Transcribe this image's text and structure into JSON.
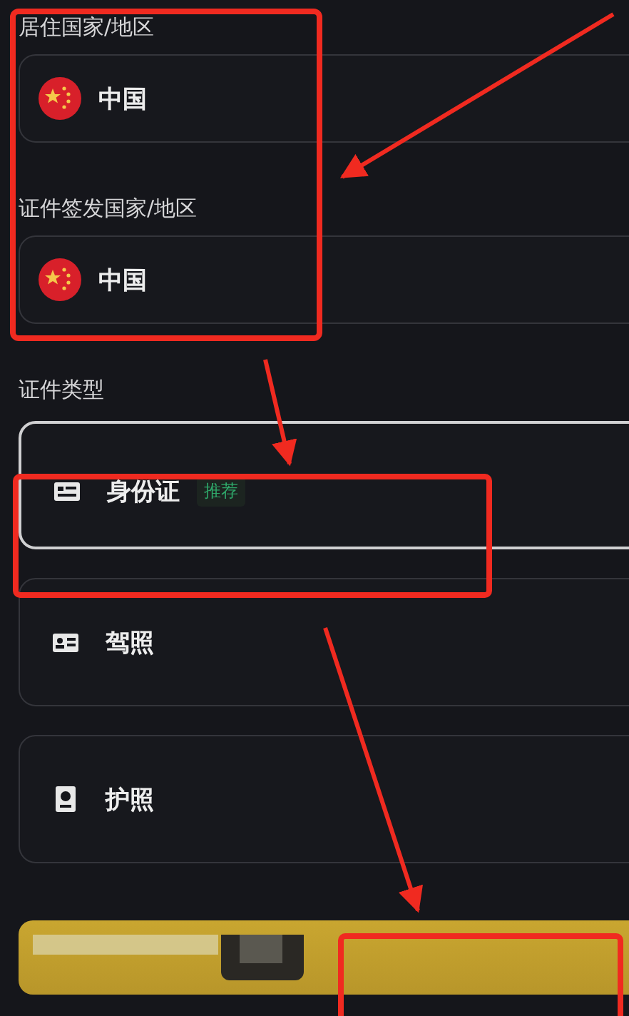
{
  "country_fields": [
    {
      "label": "居住国家/地区",
      "value": "中国"
    },
    {
      "label": "证件签发国家/地区",
      "value": "中国"
    }
  ],
  "document_type": {
    "label": "证件类型",
    "options": [
      {
        "kind": "id-card",
        "label": "身份证",
        "badge": "推荐",
        "selected": true
      },
      {
        "kind": "license",
        "label": "驾照",
        "selected": false
      },
      {
        "kind": "passport",
        "label": "护照",
        "selected": false
      }
    ]
  }
}
